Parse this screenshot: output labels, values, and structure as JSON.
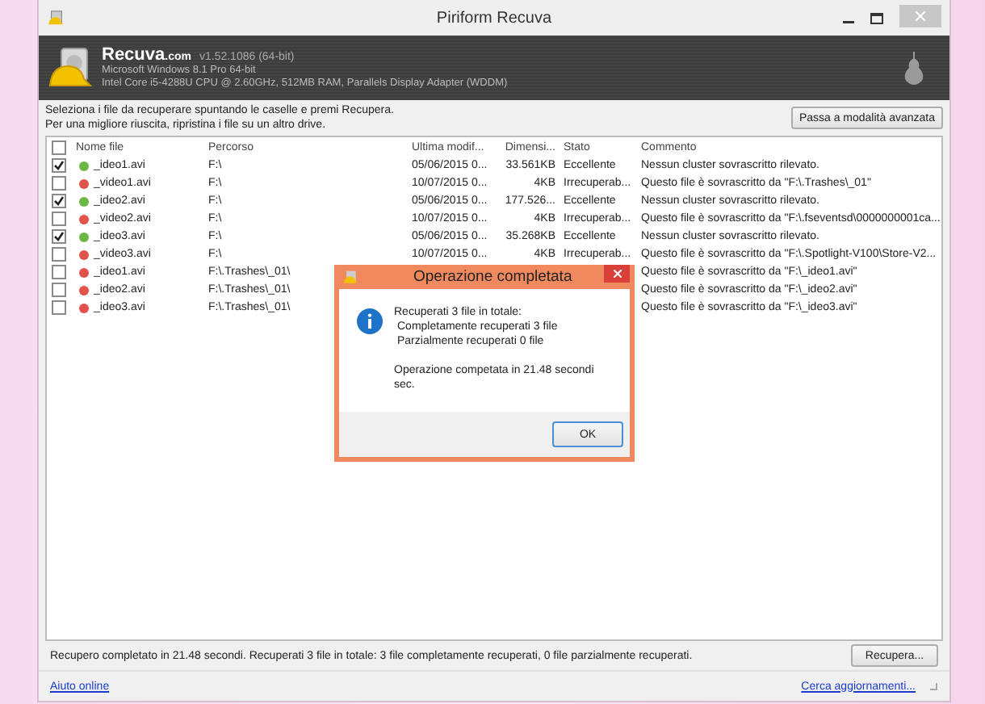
{
  "window": {
    "title": "Piriform Recuva"
  },
  "header": {
    "product": "Recuva",
    "domain": ".com",
    "version": "v1.52.1086 (64-bit)",
    "os": "Microsoft Windows 8.1 Pro 64-bit",
    "hardware": "Intel Core i5-4288U CPU @ 2.60GHz, 512MB RAM, Parallels Display Adapter (WDDM)"
  },
  "instructions": [
    "Seleziona i file da recuperare spuntando le caselle e premi Recupera.",
    "Per una migliore riuscita, ripristina i file su un altro drive."
  ],
  "advanced_button": "Passa a modalità avanzata",
  "table": {
    "select_all_checked": false,
    "columns": [
      "Nome file",
      "Percorso",
      "Ultima modif...",
      "Dimensi...",
      "Stato",
      "Commento"
    ],
    "rows": [
      {
        "checked": true,
        "color": "#6cb845",
        "name": "_ideo1.avi",
        "path": "F:\\",
        "modified": "05/06/2015 0...",
        "size": "33.561KB",
        "state": "Eccellente",
        "comment": "Nessun cluster sovrascritto rilevato."
      },
      {
        "checked": false,
        "color": "#e0524a",
        "name": "_video1.avi",
        "path": "F:\\",
        "modified": "10/07/2015 0...",
        "size": "4KB",
        "state": "Irrecuperab...",
        "comment": "Questo file è sovrascritto da \"F:\\.Trashes\\_01\""
      },
      {
        "checked": true,
        "color": "#6cb845",
        "name": "_ideo2.avi",
        "path": "F:\\",
        "modified": "05/06/2015 0...",
        "size": "177.526...",
        "state": "Eccellente",
        "comment": "Nessun cluster sovrascritto rilevato."
      },
      {
        "checked": false,
        "color": "#e0524a",
        "name": "_video2.avi",
        "path": "F:\\",
        "modified": "10/07/2015 0...",
        "size": "4KB",
        "state": "Irrecuperab...",
        "comment": "Questo file è sovrascritto da \"F:\\.fseventsd\\0000000001ca..."
      },
      {
        "checked": true,
        "color": "#6cb845",
        "name": "_ideo3.avi",
        "path": "F:\\",
        "modified": "05/06/2015 0...",
        "size": "35.268KB",
        "state": "Eccellente",
        "comment": "Nessun cluster sovrascritto rilevato."
      },
      {
        "checked": false,
        "color": "#e0524a",
        "name": "_video3.avi",
        "path": "F:\\",
        "modified": "10/07/2015 0...",
        "size": "4KB",
        "state": "Irrecuperab...",
        "comment": "Questo file è sovrascritto da \"F:\\.Spotlight-V100\\Store-V2..."
      },
      {
        "checked": false,
        "color": "#e0524a",
        "name": "_ideo1.avi",
        "path": "F:\\.Trashes\\_01\\",
        "comment": "Questo file è sovrascritto da \"F:\\_ideo1.avi\""
      },
      {
        "checked": false,
        "color": "#e0524a",
        "name": "_ideo2.avi",
        "path": "F:\\.Trashes\\_01\\",
        "comment": "Questo file è sovrascritto da \"F:\\_ideo2.avi\""
      },
      {
        "checked": false,
        "color": "#e0524a",
        "name": "_ideo3.avi",
        "path": "F:\\.Trashes\\_01\\",
        "comment": "Questo file è sovrascritto da \"F:\\_ideo3.avi\""
      }
    ]
  },
  "dialog": {
    "title": "Operazione completata",
    "lines": [
      "Recuperati 3 file in totale:",
      "Completamente recuperati 3 file",
      "Parzialmente recuperati 0 file"
    ],
    "summary": "Operazione competata in 21.48 secondi sec.",
    "ok": "OK"
  },
  "status_bar": {
    "text": "Recupero completato in 21.48 secondi. Recuperati 3 file in totale: 3 file completamente recuperati, 0 file parzialmente recuperati.",
    "button": "Recupera..."
  },
  "footer": {
    "help_link": "Aiuto online",
    "update_link": "Cerca aggiornamenti..."
  }
}
